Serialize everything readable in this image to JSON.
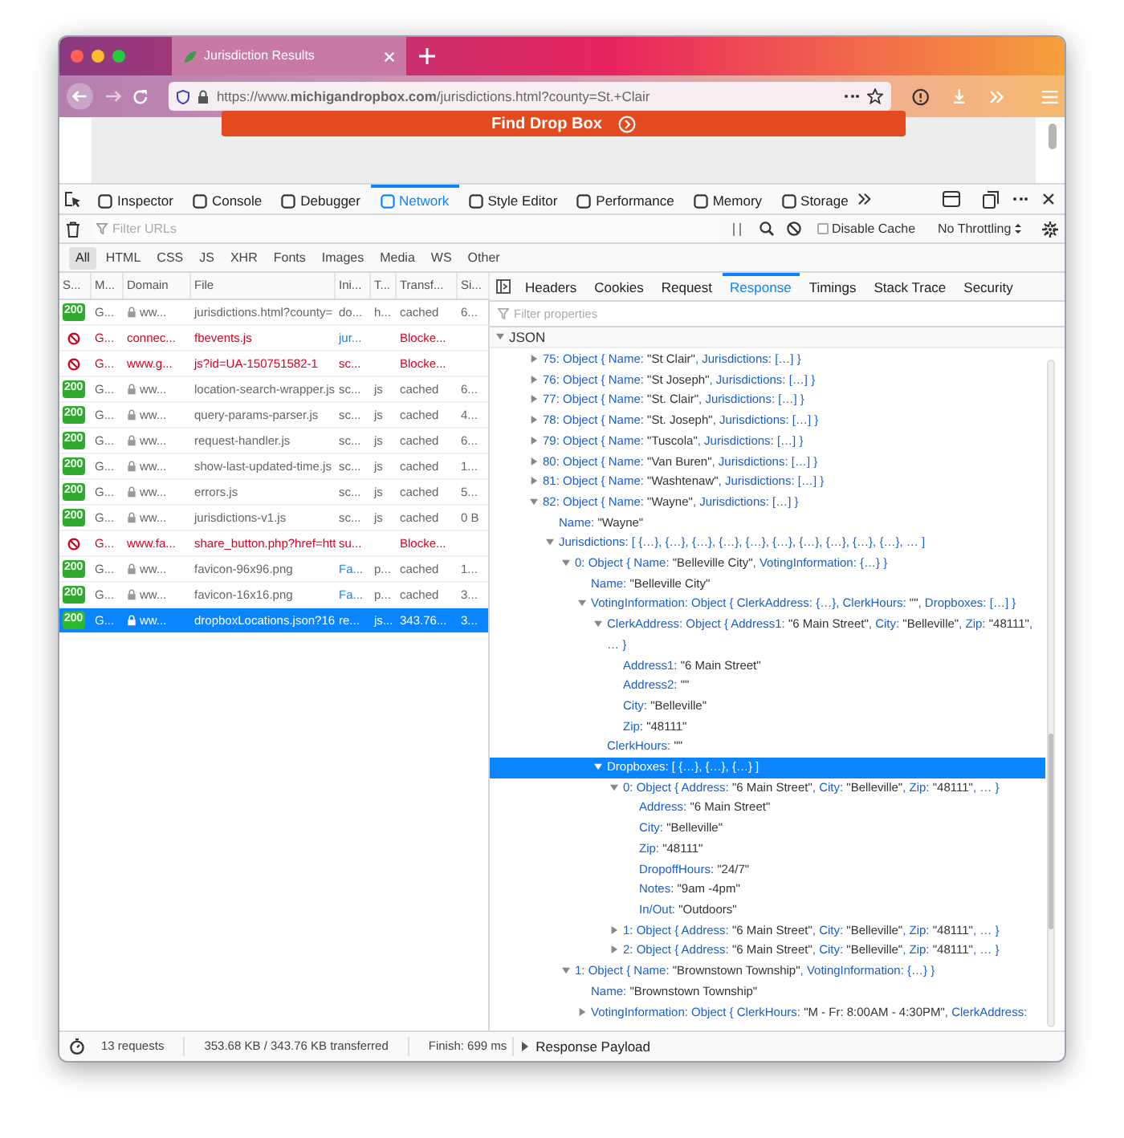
{
  "browser": {
    "tab_title": "Jurisdiction Results",
    "url": "https://www.**michigandropbox.com**/jurisdictions.html?county=St.+Clair",
    "page_button": "Find Drop Box"
  },
  "devtools": {
    "tools": [
      {
        "label": "Inspector",
        "selected": false
      },
      {
        "label": "Console",
        "selected": false
      },
      {
        "label": "Debugger",
        "selected": false
      },
      {
        "label": "Network",
        "selected": true
      },
      {
        "label": "Style Editor",
        "selected": false
      },
      {
        "label": "Performance",
        "selected": false
      },
      {
        "label": "Memory",
        "selected": false
      },
      {
        "label": "Storage",
        "selected": false
      }
    ],
    "filter": {
      "placeholder": "Filter URLs"
    },
    "disable_cache": {
      "label": "Disable Cache",
      "checked": false
    },
    "throttling": "No Throttling",
    "type_filters": [
      {
        "label": "All",
        "selected": true
      },
      {
        "label": "HTML",
        "selected": false
      },
      {
        "label": "CSS",
        "selected": false
      },
      {
        "label": "JS",
        "selected": false
      },
      {
        "label": "XHR",
        "selected": false
      },
      {
        "label": "Fonts",
        "selected": false
      },
      {
        "label": "Images",
        "selected": false
      },
      {
        "label": "Media",
        "selected": false
      },
      {
        "label": "WS",
        "selected": false
      },
      {
        "label": "Other",
        "selected": false
      }
    ]
  },
  "requests": {
    "columns": [
      "S...",
      "M...",
      "Domain",
      "File",
      "Ini...",
      "T...",
      "Transf...",
      "Si..."
    ],
    "rows": [
      {
        "kind": "ok",
        "status": "200",
        "method": "G...",
        "domain": "ww...",
        "secure": true,
        "file": "jurisdictions.html?county=",
        "initiator": "do...",
        "initiator_link": false,
        "type": "h...",
        "transferred": "cached",
        "size": "6...",
        "selected": false
      },
      {
        "kind": "blocked",
        "method": "G...",
        "domain": "connec...",
        "secure": false,
        "file": "fbevents.js",
        "initiator": "jur...",
        "initiator_link": true,
        "transferred": "Blocke...",
        "selected": false
      },
      {
        "kind": "blocked",
        "method": "G...",
        "domain": "www.g...",
        "secure": false,
        "file": "js?id=UA-150751582-1",
        "initiator": "sc...",
        "initiator_link": false,
        "transferred": "Blocke...",
        "selected": false
      },
      {
        "kind": "ok",
        "status": "200",
        "method": "G...",
        "domain": "ww...",
        "secure": true,
        "file": "location-search-wrapper.js",
        "initiator": "sc...",
        "initiator_link": false,
        "type": "js",
        "transferred": "cached",
        "size": "6...",
        "selected": false
      },
      {
        "kind": "ok",
        "status": "200",
        "method": "G...",
        "domain": "ww...",
        "secure": true,
        "file": "query-params-parser.js",
        "initiator": "sc...",
        "initiator_link": false,
        "type": "js",
        "transferred": "cached",
        "size": "4...",
        "selected": false
      },
      {
        "kind": "ok",
        "status": "200",
        "method": "G...",
        "domain": "ww...",
        "secure": true,
        "file": "request-handler.js",
        "initiator": "sc...",
        "initiator_link": false,
        "type": "js",
        "transferred": "cached",
        "size": "6...",
        "selected": false
      },
      {
        "kind": "ok",
        "status": "200",
        "method": "G...",
        "domain": "ww...",
        "secure": true,
        "file": "show-last-updated-time.js",
        "initiator": "sc...",
        "initiator_link": false,
        "type": "js",
        "transferred": "cached",
        "size": "1...",
        "selected": false
      },
      {
        "kind": "ok",
        "status": "200",
        "method": "G...",
        "domain": "ww...",
        "secure": true,
        "file": "errors.js",
        "initiator": "sc...",
        "initiator_link": false,
        "type": "js",
        "transferred": "cached",
        "size": "5...",
        "selected": false
      },
      {
        "kind": "ok",
        "status": "200",
        "method": "G...",
        "domain": "ww...",
        "secure": true,
        "file": "jurisdictions-v1.js",
        "initiator": "sc...",
        "initiator_link": false,
        "type": "js",
        "transferred": "cached",
        "size": "0 B",
        "selected": false
      },
      {
        "kind": "blocked",
        "method": "G...",
        "domain": "www.fa...",
        "secure": false,
        "file": "share_button.php?href=htt",
        "initiator": "su...",
        "initiator_link": false,
        "transferred": "Blocke...",
        "selected": false
      },
      {
        "kind": "ok",
        "status": "200",
        "method": "G...",
        "domain": "ww...",
        "secure": true,
        "file": "favicon-96x96.png",
        "initiator": "Fa...",
        "initiator_link": true,
        "type": "p...",
        "transferred": "cached",
        "size": "1...",
        "selected": false
      },
      {
        "kind": "ok",
        "status": "200",
        "method": "G...",
        "domain": "ww...",
        "secure": true,
        "file": "favicon-16x16.png",
        "initiator": "Fa...",
        "initiator_link": true,
        "type": "p...",
        "transferred": "cached",
        "size": "3...",
        "selected": false
      },
      {
        "kind": "ok",
        "status": "200",
        "method": "G...",
        "domain": "ww...",
        "secure": true,
        "file": "dropboxLocations.json?16",
        "initiator": "re...",
        "initiator_link": false,
        "type": "js...",
        "transferred": "343.76...",
        "size": "3...",
        "selected": true
      }
    ]
  },
  "details": {
    "tabs": [
      {
        "label": "Headers",
        "selected": false
      },
      {
        "label": "Cookies",
        "selected": false
      },
      {
        "label": "Request",
        "selected": false
      },
      {
        "label": "Response",
        "selected": true
      },
      {
        "label": "Timings",
        "selected": false
      },
      {
        "label": "Stack Trace",
        "selected": false
      },
      {
        "label": "Security",
        "selected": false
      }
    ],
    "filter": {
      "placeholder": "Filter properties"
    },
    "json": {
      "label": "JSON",
      "expanded": true,
      "children": [
        {
          "text": "75: Object { Name: \"St Clair\", Jurisdictions: […] }",
          "expanded": false,
          "selected": false
        },
        {
          "text": "76: Object { Name: \"St Joseph\", Jurisdictions: […] }",
          "expanded": false,
          "selected": false
        },
        {
          "text": "77: Object { Name: \"St. Clair\", Jurisdictions: […] }",
          "expanded": false,
          "selected": false
        },
        {
          "text": "78: Object { Name: \"St. Joseph\", Jurisdictions: […] }",
          "expanded": false,
          "selected": false
        },
        {
          "text": "79: Object { Name: \"Tuscola\", Jurisdictions: […] }",
          "expanded": false,
          "selected": false
        },
        {
          "text": "80: Object { Name: \"Van Buren\", Jurisdictions: […] }",
          "expanded": false,
          "selected": false
        },
        {
          "text": "81: Object { Name: \"Washtenaw\", Jurisdictions: […] }",
          "expanded": false,
          "selected": false
        },
        {
          "text": "82: Object { Name: \"Wayne\", Jurisdictions: […] }",
          "expanded": true,
          "selected": false,
          "children": [
            {
              "text": "Name: \"Wayne\"",
              "selected": false
            },
            {
              "text": "Jurisdictions: [ {…}, {…}, {…}, {…}, {…}, {…}, {…}, {…}, {…}, {…}, … ]",
              "expanded": true,
              "selected": false,
              "children": [
                {
                  "text": "0: Object { Name: \"Belleville City\", VotingInformation: {…} }",
                  "expanded": true,
                  "selected": false,
                  "children": [
                    {
                      "text": "Name: \"Belleville City\"",
                      "selected": false
                    },
                    {
                      "text": "VotingInformation: Object { ClerkAddress: {…}, ClerkHours: \"\", Dropboxes: […] }",
                      "expanded": true,
                      "selected": false,
                      "children": [
                        {
                          "text": "ClerkAddress: Object { Address1: \"6 Main Street\", City: \"Belleville\", Zip: \"48111\", … }",
                          "expanded": true,
                          "selected": false,
                          "children": [
                            {
                              "text": "Address1: \"6 Main Street\"",
                              "selected": false
                            },
                            {
                              "text": "Address2: \"\"",
                              "selected": false
                            },
                            {
                              "text": "City: \"Belleville\"",
                              "selected": false
                            },
                            {
                              "text": "Zip: \"48111\"",
                              "selected": false
                            }
                          ]
                        },
                        {
                          "text": "ClerkHours: \"\"",
                          "selected": false
                        },
                        {
                          "text": "Dropboxes: [ {…}, {…}, {…} ]",
                          "expanded": true,
                          "selected": true,
                          "children": [
                            {
                              "text": "0: Object { Address: \"6 Main Street\", City: \"Belleville\", Zip: \"48111\", … }",
                              "expanded": true,
                              "selected": false,
                              "children": [
                                {
                                  "text": "Address: \"6 Main Street\"",
                                  "selected": false
                                },
                                {
                                  "text": "City: \"Belleville\"",
                                  "selected": false
                                },
                                {
                                  "text": "Zip: \"48111\"",
                                  "selected": false
                                },
                                {
                                  "text": "DropoffHours: \"24/7\"",
                                  "selected": false
                                },
                                {
                                  "text": "Notes: \"9am -4pm\"",
                                  "selected": false
                                },
                                {
                                  "text": "In/Out: \"Outdoors\"",
                                  "selected": false
                                }
                              ]
                            },
                            {
                              "text": "1: Object { Address: \"6 Main Street\", City: \"Belleville\", Zip: \"48111\", … }",
                              "expanded": false,
                              "selected": false
                            },
                            {
                              "text": "2: Object { Address: \"6 Main Street\", City: \"Belleville\", Zip: \"48111\", … }",
                              "expanded": false,
                              "selected": false
                            }
                          ]
                        }
                      ]
                    }
                  ]
                },
                {
                  "text": "1: Object { Name: \"Brownstown Township\", VotingInformation: {…} }",
                  "expanded": true,
                  "selected": false,
                  "children": [
                    {
                      "text": "Name: \"Brownstown Township\"",
                      "selected": false
                    },
                    {
                      "text": "VotingInformation: Object { ClerkHours: \"M - Fr: 8:00AM - 4:30PM\", ClerkAddress:",
                      "expanded": false,
                      "selected": false
                    }
                  ]
                }
              ]
            }
          ]
        }
      ]
    }
  },
  "status_bar": {
    "requests": "13 requests",
    "transferred": "353.68 KB / 343.76 KB transferred",
    "finish": "Finish: 699 ms",
    "payload": "Response Payload"
  }
}
